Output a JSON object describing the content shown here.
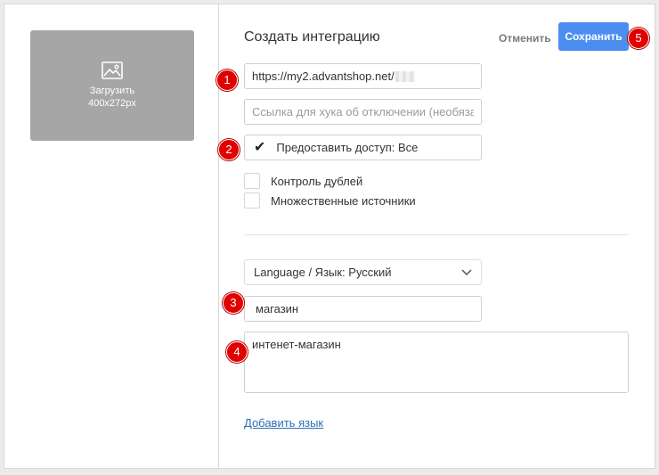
{
  "upload": {
    "label": "Загрузить",
    "size": "400x272px",
    "icon": "image-icon"
  },
  "header": {
    "title": "Создать интеграцию",
    "cancel_label": "Отменить",
    "save_label": "Сохранить"
  },
  "form": {
    "url_value": "https://my2.advantshop.net/",
    "unsubscribe_hook_placeholder": "Ссылка для хука об отключении (необязательно)",
    "access": {
      "checked": true,
      "label": "Предоставить доступ: Все"
    },
    "duplicate_control": {
      "checked": false,
      "label": "Контроль дублей"
    },
    "multiple_sources": {
      "checked": false,
      "label": "Множественные источники"
    },
    "language_select": {
      "label": "Language / Язык: Русский"
    },
    "name_value": "магазин",
    "description_value": "интенет-магазин",
    "add_language_label": "Добавить язык"
  },
  "badges": [
    "1",
    "2",
    "3",
    "4",
    "5"
  ],
  "colors": {
    "primary_button": "#4c8ef0",
    "badge": "#e00000",
    "link": "#2b6fb6"
  }
}
